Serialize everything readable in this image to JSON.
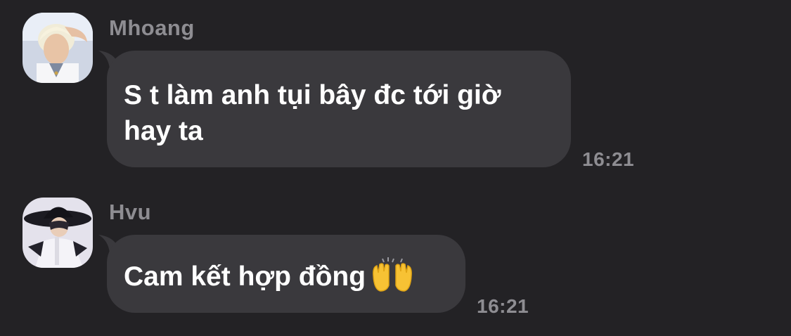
{
  "messages": [
    {
      "sender": "Mhoang",
      "text_lines": [
        "S t làm anh tụi bây đc tới giờ",
        "hay ta"
      ],
      "time": "16:21",
      "avatar": "profile-photo-blonde-person"
    },
    {
      "sender": "Hvu",
      "text": "Cam kết hợp đồng",
      "emoji": "raising-hands-emoji",
      "time": "16:21",
      "avatar": "profile-photo-person-in-black-hat"
    }
  ],
  "colors": {
    "background": "#232225",
    "bubble": "#3a393d",
    "text": "#ffffff",
    "meta": "#8e8d92"
  }
}
